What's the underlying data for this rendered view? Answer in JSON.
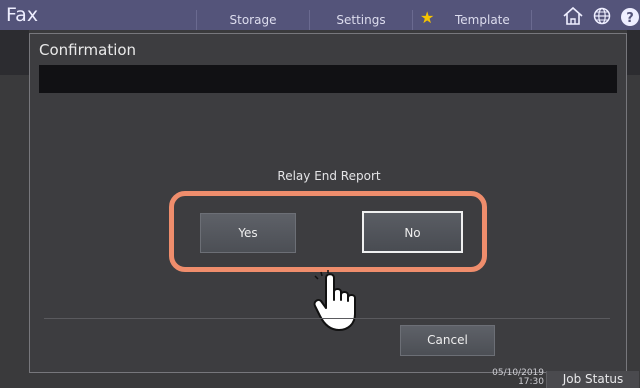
{
  "header": {
    "app_title": "Fax",
    "tabs": {
      "storage": "Storage",
      "settings": "Settings",
      "template": "Template"
    },
    "icons": [
      "star-icon",
      "home-icon",
      "globe-icon",
      "help-icon"
    ]
  },
  "dialog": {
    "title": "Confirmation",
    "message": "Relay End Report",
    "yes_label": "Yes",
    "no_label": "No",
    "cancel_label": "Cancel"
  },
  "footer": {
    "date": "05/10/2019",
    "time": "17:30",
    "job_status": "Job Status"
  },
  "colors": {
    "topbar": "#54547a",
    "dialog_bg": "#3d3d40",
    "highlight": "#ef8d6c",
    "star": "#f5c400"
  }
}
